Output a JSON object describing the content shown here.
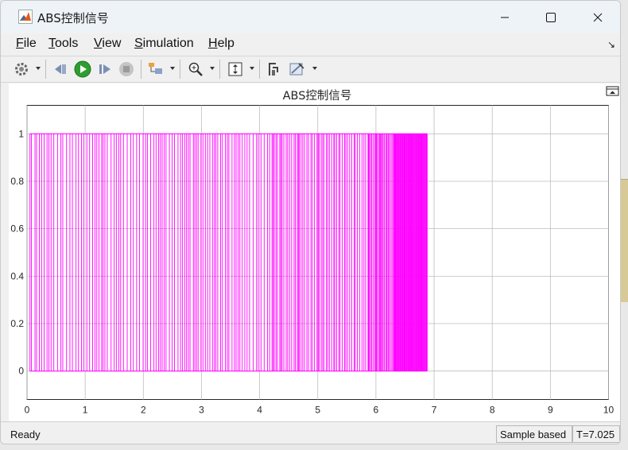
{
  "window": {
    "title": "ABS控制信号"
  },
  "menu": [
    {
      "label": "File",
      "mnemonic": "F",
      "rest": "ile"
    },
    {
      "label": "Tools",
      "mnemonic": "T",
      "rest": "ools"
    },
    {
      "label": "View",
      "mnemonic": "V",
      "rest": "iew"
    },
    {
      "label": "Simulation",
      "mnemonic": "S",
      "rest": "imulation"
    },
    {
      "label": "Help",
      "mnemonic": "H",
      "rest": "elp"
    }
  ],
  "toolbar": {
    "icons": [
      "settings-icon",
      "step-back-icon",
      "run-icon",
      "step-forward-icon",
      "stop-icon",
      "signal-selector-icon",
      "zoom-icon",
      "autoscale-icon",
      "cursor-measure-icon",
      "style-icon"
    ],
    "run_color": "#2e9e2e"
  },
  "chart_data": {
    "type": "line",
    "title": "ABS控制信号",
    "xlabel": "",
    "ylabel": "",
    "xlim": [
      0,
      10
    ],
    "ylim": [
      -0.12,
      1.12
    ],
    "xticks": [
      "0",
      "1",
      "2",
      "3",
      "4",
      "5",
      "6",
      "7",
      "8",
      "9",
      "10"
    ],
    "yticks": [
      "0",
      "0.2",
      "0.4",
      "0.6",
      "0.8",
      "1"
    ],
    "grid": true,
    "series": [
      {
        "signal": "binary pulse train switching between 0 and 1",
        "color": "#ff00ff",
        "x_start": 0.05,
        "x_end": 6.88,
        "low": 0,
        "high": 1
      }
    ]
  },
  "status": {
    "ready": "Ready",
    "mode": "Sample based",
    "time": "T=7.025"
  }
}
